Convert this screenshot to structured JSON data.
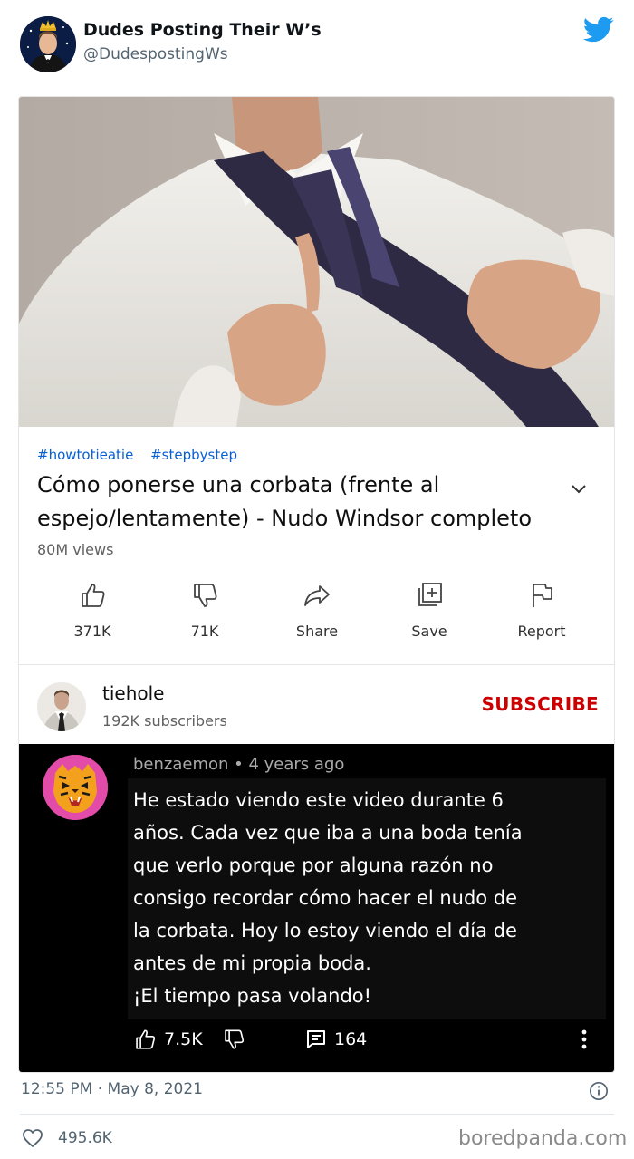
{
  "tweet": {
    "display_name": "Dudes Posting Their W’s",
    "handle": "@DudespostingWs",
    "timestamp": "12:55 PM · May 8, 2021",
    "likes": "495.6K"
  },
  "video": {
    "hashtags": [
      "#howtotieatie",
      "#stepbystep"
    ],
    "title_lines": [
      "Cómo ponerse una corbata (frente al",
      "espejo/lentamente) - Nudo Windsor completo"
    ],
    "views": "80M views",
    "actions": [
      {
        "icon": "thumbs-up-icon",
        "label": "371K"
      },
      {
        "icon": "thumbs-down-icon",
        "label": "71K"
      },
      {
        "icon": "share-icon",
        "label": "Share"
      },
      {
        "icon": "save-playlist-icon",
        "label": "Save"
      },
      {
        "icon": "flag-icon",
        "label": "Report"
      }
    ]
  },
  "channel": {
    "name": "tiehole",
    "subscribers": "192K subscribers",
    "subscribe_label": "SUBSCRIBE"
  },
  "comment": {
    "author_line": "benzaemon • 4 years ago",
    "text_lines": [
      "He estado viendo este video durante 6",
      "años. Cada vez que iba a una boda tenía",
      "que verlo porque por alguna razón no",
      "consigo recordar cómo hacer el nudo de",
      "la corbata. Hoy lo estoy viendo el día de",
      "antes de mi propia boda.",
      "¡El tiempo pasa volando!"
    ],
    "likes": "7.5K",
    "replies": "164"
  },
  "watermark": "boredpanda.com",
  "colors": {
    "twitter_blue": "#1d9bf0",
    "youtube_red": "#cc0000",
    "hashtag_blue": "#065fd4",
    "secondary_text": "#536471"
  }
}
